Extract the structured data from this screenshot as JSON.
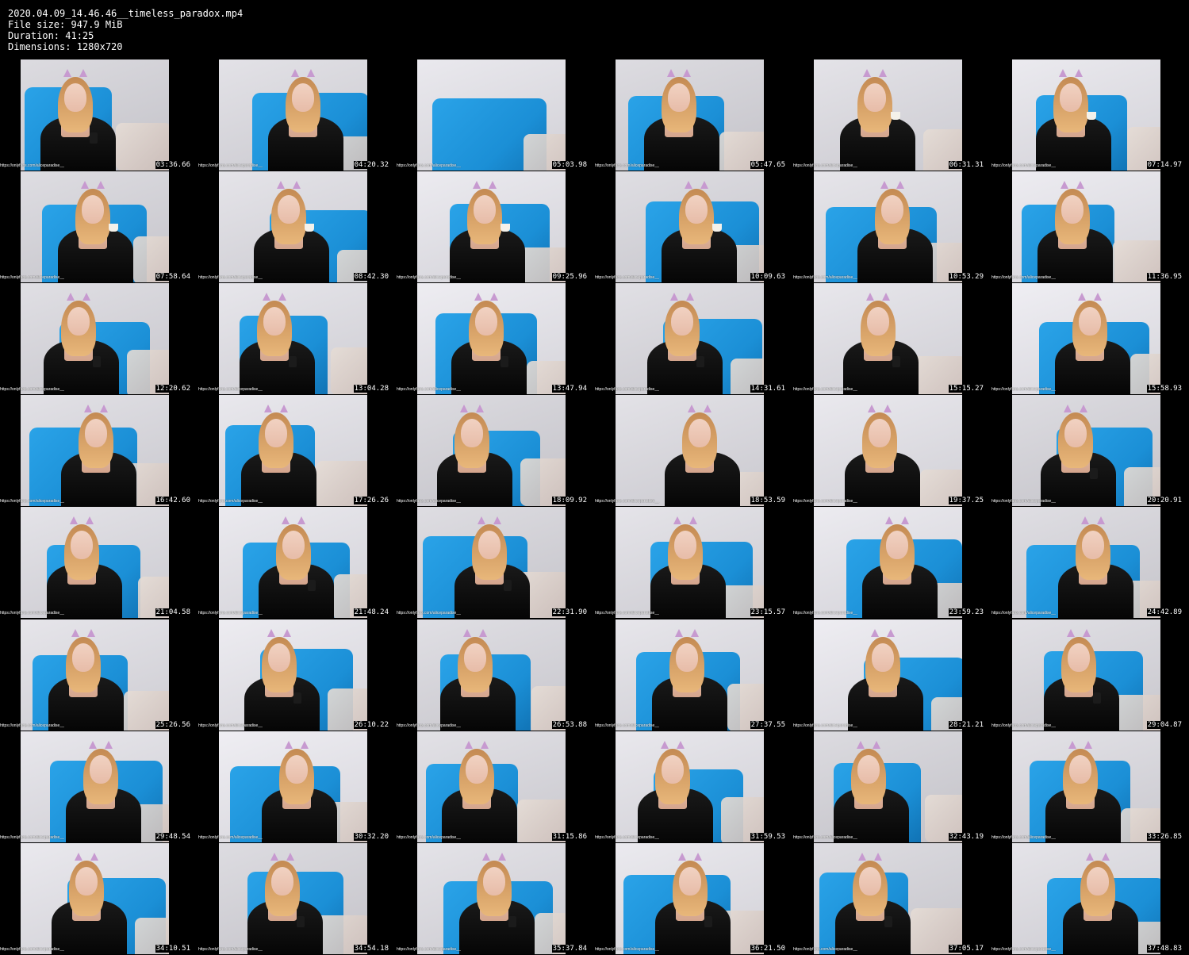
{
  "header": {
    "filename": "2020.04.09_14.46.46__timeless_paradox.mp4",
    "filesize_line": "File size: 947.9 MiB",
    "duration_line": "Duration: 41:25",
    "dimensions_line": "Dimensions: 1280x720"
  },
  "watermark_text": "https://onlyfans.com/aliceparadise__",
  "colors": {
    "background": "#000000",
    "text": "#ffffff",
    "wall": "#d9d8de",
    "blanket": "#1b8fd6",
    "robe": "#111111",
    "hair": "#d9a46a",
    "cat_ears": "#c79ad0"
  },
  "thumbnails": [
    {
      "timestamp": "03:36.66",
      "prop": "phone",
      "blanket": true
    },
    {
      "timestamp": "04:20.32",
      "prop": "none",
      "blanket": true
    },
    {
      "timestamp": "05:03.98",
      "prop": "empty",
      "blanket": true
    },
    {
      "timestamp": "05:47.65",
      "prop": "none",
      "blanket": true
    },
    {
      "timestamp": "06:31.31",
      "prop": "cup",
      "blanket": false
    },
    {
      "timestamp": "07:14.97",
      "prop": "cup",
      "blanket": true
    },
    {
      "timestamp": "07:58.64",
      "prop": "cup",
      "blanket": true
    },
    {
      "timestamp": "08:42.30",
      "prop": "cup",
      "blanket": true
    },
    {
      "timestamp": "09:25.96",
      "prop": "cup",
      "blanket": true
    },
    {
      "timestamp": "10:09.63",
      "prop": "cup",
      "blanket": true
    },
    {
      "timestamp": "10:53.29",
      "prop": "none",
      "blanket": true
    },
    {
      "timestamp": "11:36.95",
      "prop": "none",
      "blanket": true
    },
    {
      "timestamp": "12:20.62",
      "prop": "phone",
      "blanket": true
    },
    {
      "timestamp": "13:04.28",
      "prop": "phone",
      "blanket": true
    },
    {
      "timestamp": "13:47.94",
      "prop": "phone",
      "blanket": true
    },
    {
      "timestamp": "14:31.61",
      "prop": "phone",
      "blanket": true
    },
    {
      "timestamp": "15:15.27",
      "prop": "phone",
      "blanket": false
    },
    {
      "timestamp": "15:58.93",
      "prop": "none",
      "blanket": true
    },
    {
      "timestamp": "16:42.60",
      "prop": "none",
      "blanket": true
    },
    {
      "timestamp": "17:26.26",
      "prop": "none",
      "blanket": true
    },
    {
      "timestamp": "18:09.92",
      "prop": "none",
      "blanket": true
    },
    {
      "timestamp": "18:53.59",
      "prop": "none",
      "blanket": false
    },
    {
      "timestamp": "19:37.25",
      "prop": "none",
      "blanket": false
    },
    {
      "timestamp": "20:20.91",
      "prop": "phone",
      "blanket": true
    },
    {
      "timestamp": "21:04.58",
      "prop": "none",
      "blanket": true
    },
    {
      "timestamp": "21:48.24",
      "prop": "phone",
      "blanket": true
    },
    {
      "timestamp": "22:31.90",
      "prop": "phone",
      "blanket": true
    },
    {
      "timestamp": "23:15.57",
      "prop": "none",
      "blanket": true
    },
    {
      "timestamp": "23:59.23",
      "prop": "none",
      "blanket": true
    },
    {
      "timestamp": "24:42.89",
      "prop": "none",
      "blanket": true
    },
    {
      "timestamp": "25:26.56",
      "prop": "none",
      "blanket": true
    },
    {
      "timestamp": "26:10.22",
      "prop": "phone",
      "blanket": true
    },
    {
      "timestamp": "26:53.88",
      "prop": "none",
      "blanket": true
    },
    {
      "timestamp": "27:37.55",
      "prop": "none",
      "blanket": true
    },
    {
      "timestamp": "28:21.21",
      "prop": "none",
      "blanket": true
    },
    {
      "timestamp": "29:04.87",
      "prop": "phone",
      "blanket": true
    },
    {
      "timestamp": "29:48.54",
      "prop": "none",
      "blanket": true
    },
    {
      "timestamp": "30:32.20",
      "prop": "none",
      "blanket": true
    },
    {
      "timestamp": "31:15.86",
      "prop": "none",
      "blanket": true
    },
    {
      "timestamp": "31:59.53",
      "prop": "none",
      "blanket": true
    },
    {
      "timestamp": "32:43.19",
      "prop": "none",
      "blanket": true
    },
    {
      "timestamp": "33:26.85",
      "prop": "none",
      "blanket": true
    },
    {
      "timestamp": "34:10.51",
      "prop": "none",
      "blanket": true
    },
    {
      "timestamp": "34:54.18",
      "prop": "phone",
      "blanket": true
    },
    {
      "timestamp": "35:37.84",
      "prop": "phone",
      "blanket": true
    },
    {
      "timestamp": "36:21.50",
      "prop": "phone",
      "blanket": true
    },
    {
      "timestamp": "37:05.17",
      "prop": "phone",
      "blanket": true
    },
    {
      "timestamp": "37:48.83",
      "prop": "none",
      "blanket": true
    }
  ]
}
